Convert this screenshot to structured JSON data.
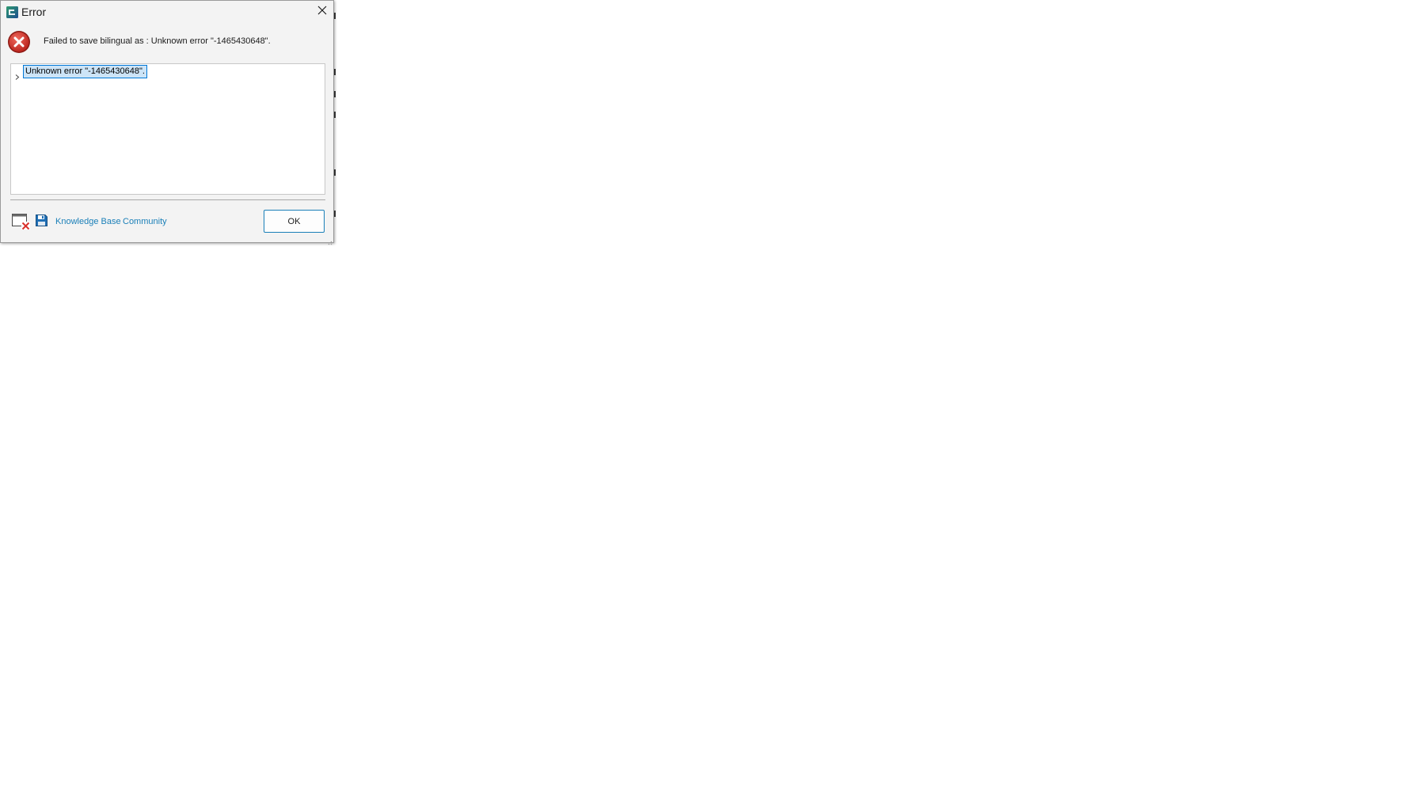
{
  "dialog": {
    "title": "Error",
    "message": "Failed to save bilingual as : Unknown error \"-1465430648\".",
    "details": [
      {
        "label": "Unknown error \"-1465430648\"."
      }
    ],
    "links": {
      "knowledge_base": "Knowledge Base",
      "community": "Community"
    },
    "ok_label": "OK"
  },
  "colors": {
    "link": "#1a7fb8",
    "error_red": "#d9312b",
    "selection": "#cce4f7",
    "selection_border": "#0078d7"
  },
  "icons": {
    "app": "app-icon",
    "close": "close-icon",
    "error": "error-icon",
    "expand": "chevron-right-icon",
    "report": "error-report-icon",
    "save": "save-icon"
  }
}
